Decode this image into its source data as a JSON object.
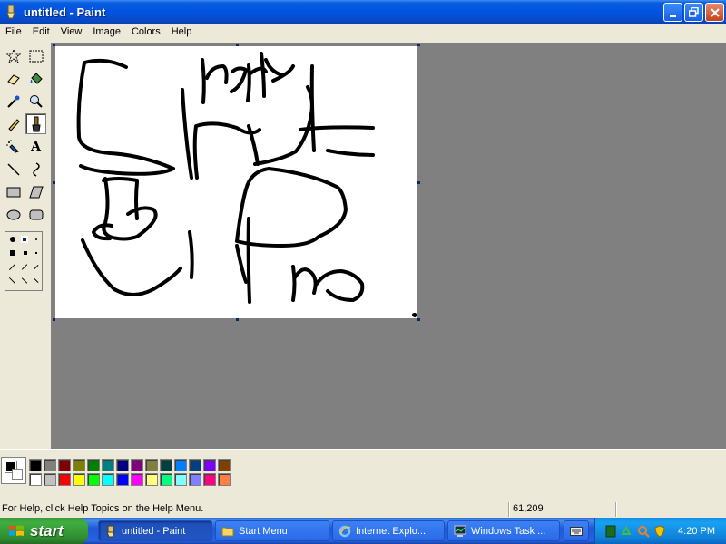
{
  "window": {
    "title": "untitled - Paint",
    "buttons": [
      "minimize",
      "maximize",
      "close"
    ]
  },
  "menu": [
    "File",
    "Edit",
    "View",
    "Image",
    "Colors",
    "Help"
  ],
  "tools": [
    {
      "name": "free-form-select",
      "icon": "star-select-icon"
    },
    {
      "name": "select",
      "icon": "rect-select-icon"
    },
    {
      "name": "eraser",
      "icon": "eraser-icon"
    },
    {
      "name": "fill",
      "icon": "paint-bucket-icon"
    },
    {
      "name": "pick-color",
      "icon": "eyedropper-icon"
    },
    {
      "name": "magnifier",
      "icon": "magnifier-icon"
    },
    {
      "name": "pencil",
      "icon": "pencil-icon"
    },
    {
      "name": "brush",
      "icon": "brush-icon",
      "active": true
    },
    {
      "name": "airbrush",
      "icon": "airbrush-icon"
    },
    {
      "name": "text",
      "icon": "text-icon",
      "glyph": "A"
    },
    {
      "name": "line",
      "icon": "line-icon"
    },
    {
      "name": "curve",
      "icon": "curve-icon"
    },
    {
      "name": "rectangle",
      "icon": "rectangle-icon"
    },
    {
      "name": "polygon",
      "icon": "polygon-icon"
    },
    {
      "name": "ellipse",
      "icon": "ellipse-icon"
    },
    {
      "name": "rounded-rectangle",
      "icon": "rounded-rect-icon"
    }
  ],
  "palette": {
    "foreground": "#000000",
    "background": "#ffffff",
    "colors": [
      "#000000",
      "#808080",
      "#800000",
      "#808000",
      "#008000",
      "#008080",
      "#000080",
      "#800080",
      "#808040",
      "#004040",
      "#0080ff",
      "#004080",
      "#8000ff",
      "#804000",
      "#ffffff",
      "#c0c0c0",
      "#ff0000",
      "#ffff00",
      "#00ff00",
      "#00ffff",
      "#0000ff",
      "#ff00ff",
      "#ffff80",
      "#00ff80",
      "#80ffff",
      "#8080ff",
      "#ff0080",
      "#ff8040"
    ]
  },
  "status": {
    "help_text": "For Help, click Help Topics on the Help Menu.",
    "coords": "61,209"
  },
  "taskbar": {
    "start_label": "start",
    "tasks": [
      {
        "label": "untitled - Paint",
        "icon": "paint-icon",
        "active": true
      },
      {
        "label": "Start Menu",
        "icon": "folder-icon",
        "active": false
      },
      {
        "label": "Internet Explo...",
        "icon": "ie-icon",
        "active": false
      },
      {
        "label": "Windows Task ...",
        "icon": "task-manager-icon",
        "active": false
      }
    ],
    "clock": "4:20 PM"
  }
}
